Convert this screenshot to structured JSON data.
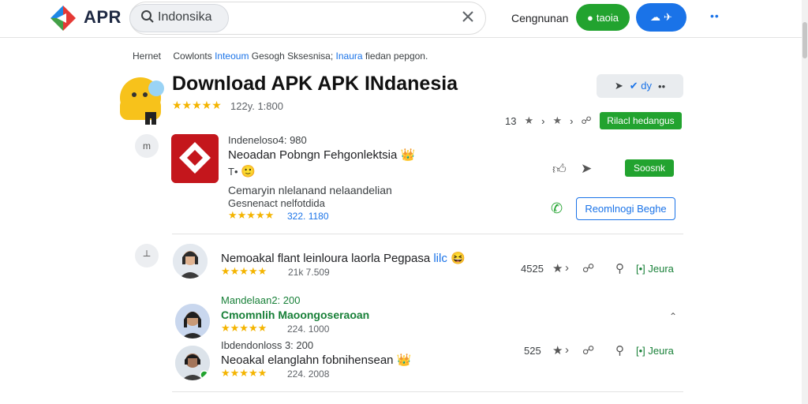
{
  "header": {
    "brand": "APR",
    "search_value": "Indonsika",
    "nav_link": "Cengnunan",
    "green_pill_label": "taoia",
    "blue_pill_label": "✈",
    "more": "••"
  },
  "breadcrumb": {
    "items": [
      "Hernet",
      "Cowlonts",
      "Inteoum",
      "Gesogh",
      "Sksesnisa;",
      "Inaura",
      "fiedan pepgon."
    ]
  },
  "app": {
    "title": "Download APK APK INdanesia",
    "stars": "★★★★★",
    "count": "122y. 1:800",
    "actions_label": "✔ dy",
    "rating_value": "13",
    "primary_button": "Rilacl hedangus"
  },
  "featured": {
    "badge": "m",
    "meta": "Indeneloso4: 980",
    "name": "Neoadan Pobngn Fehgonlektsia",
    "sub": "T•",
    "desc1": "Cemaryin nlelanand nelaandelian",
    "desc2": "Gesnenact nelfotdida",
    "stars": "★★★★★",
    "count": "322. 1180",
    "green_button": "Soosnk",
    "outline_button": "Reomlnogi Beghe"
  },
  "reviews": [
    {
      "badge": "┴",
      "title": "Nemoakal flant leinloura laorla Pegpasa",
      "title_link": "lilc",
      "stars": "★★★★★",
      "count": "21k 7.509",
      "score": "4525",
      "action": "[•] Jeura"
    },
    {
      "meta": "Mandelaan2: 200",
      "name": "Cmomnlih Maoongoseraoan",
      "stars": "★★★★★",
      "count": "224. 1000"
    },
    {
      "meta": "Ibdendonloss  3: 200",
      "title": "Neoakal elanglahn fobnihensean",
      "stars": "★★★★★",
      "count": "224. 2008",
      "score": "525",
      "action": "[•] Jeura"
    }
  ],
  "colors": {
    "brand_green": "#22a32f",
    "brand_blue": "#1a73e8",
    "brand_red": "#c4161c",
    "star": "#f4b400"
  }
}
